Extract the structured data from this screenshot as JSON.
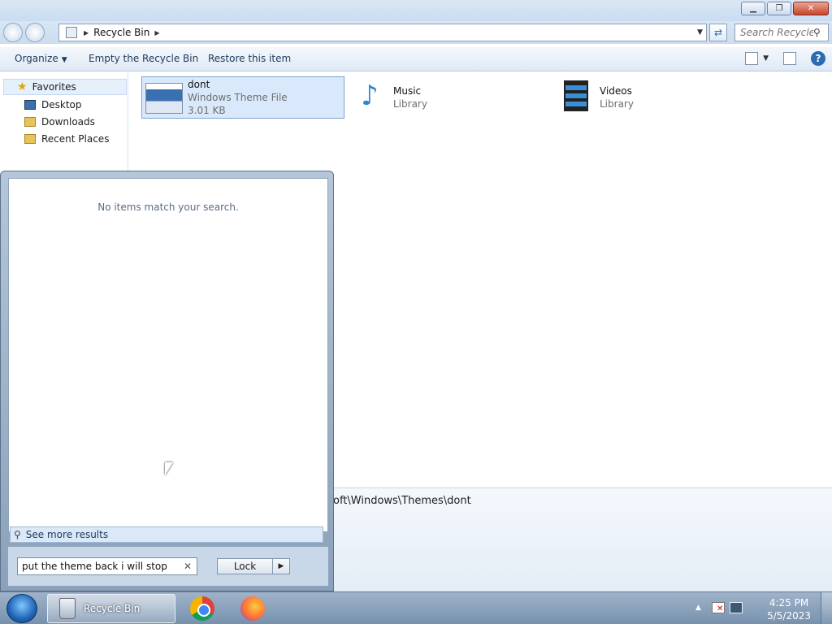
{
  "window": {
    "address": {
      "crumb": "Recycle Bin"
    },
    "search": {
      "placeholder": "Search Recycle..."
    }
  },
  "toolbar": {
    "organize": "Organize",
    "empty": "Empty the Recycle Bin",
    "restore": "Restore this item"
  },
  "nav": {
    "favorites": "Favorites",
    "items": [
      "Desktop",
      "Downloads",
      "Recent Places"
    ]
  },
  "content": {
    "items": [
      {
        "name": "dont",
        "type": "Windows Theme File",
        "size": "3.01 KB",
        "selected": true
      },
      {
        "name": "Music",
        "type": "Library"
      },
      {
        "name": "Videos",
        "type": "Library"
      }
    ]
  },
  "details": {
    "path": "oft\\Windows\\Themes\\dont"
  },
  "startmenu": {
    "no_results": "No items match your search.",
    "see_more": "See more results",
    "query": "put the theme back i will stop",
    "lock": "Lock"
  },
  "taskbar": {
    "active_label": "Recycle Bin",
    "time": "4:25 PM",
    "date": "5/5/2023"
  },
  "colors": {
    "accent": "#2b6bb3",
    "selection": "#d9e9fb"
  }
}
